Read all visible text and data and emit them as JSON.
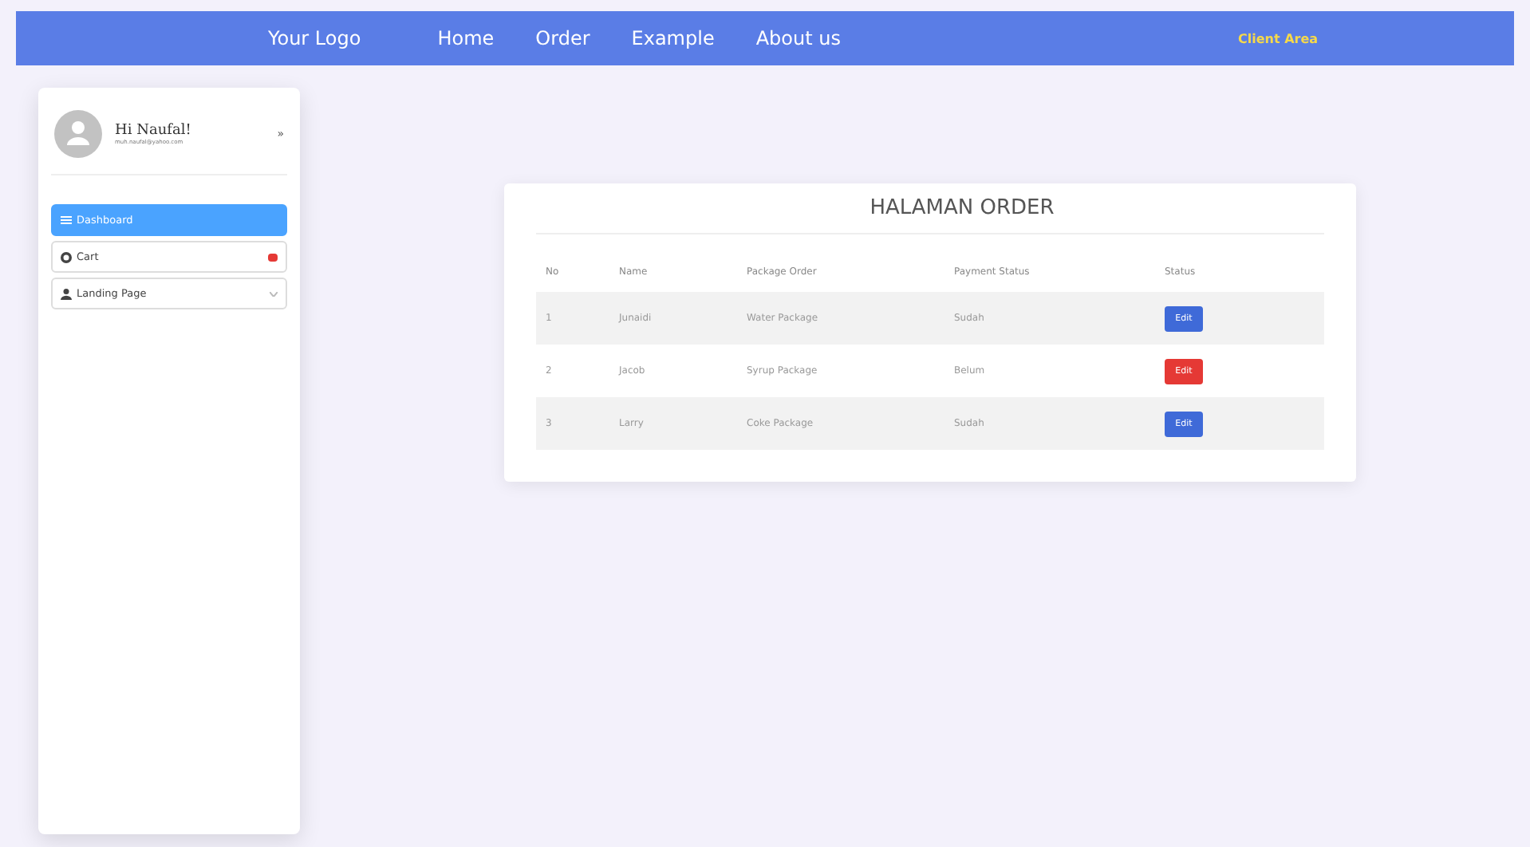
{
  "navbar": {
    "logo": "Your Logo",
    "links": [
      "Home",
      "Order",
      "Example",
      "About us"
    ],
    "client_area": "Client Area"
  },
  "sidebar": {
    "user": {
      "greeting": "Hi Naufal!",
      "email": "muh.naufal@yahoo.com"
    },
    "toggle": "»",
    "items": [
      {
        "label": "Dashboard",
        "selected": true,
        "kind": "menu",
        "badge": false,
        "dropdown": false
      },
      {
        "label": "Cart",
        "selected": false,
        "kind": "gear",
        "badge": true,
        "dropdown": false
      },
      {
        "label": "Landing Page",
        "selected": false,
        "kind": "person",
        "badge": false,
        "dropdown": true
      }
    ]
  },
  "order": {
    "title": "HALAMAN ORDER",
    "columns": [
      "No",
      "Name",
      "Package Order",
      "Payment Status",
      "Status"
    ],
    "rows": [
      {
        "no": "1",
        "name": "Junaidi",
        "package": "Water Package",
        "payment": "Sudah",
        "action": {
          "label": "Edit",
          "color": "#3f6ad8"
        }
      },
      {
        "no": "2",
        "name": "Jacob",
        "package": "Syrup Package",
        "payment": "Belum",
        "action": {
          "label": "Edit",
          "color": "#e53935"
        }
      },
      {
        "no": "3",
        "name": "Larry",
        "package": "Coke Package",
        "payment": "Sudah",
        "action": {
          "label": "Edit",
          "color": "#3f6ad8"
        }
      }
    ]
  }
}
